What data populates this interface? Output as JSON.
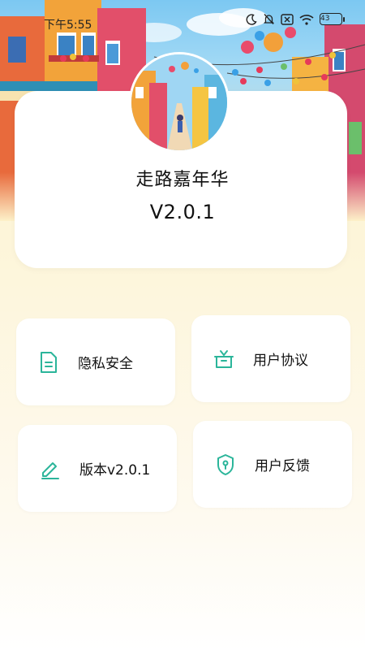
{
  "status_bar": {
    "time": "下午5:55",
    "battery_level": "43",
    "icons": [
      "moon-icon",
      "bell-off-icon",
      "sim-x-icon",
      "wifi-icon",
      "battery-icon"
    ]
  },
  "app": {
    "name": "走路嘉年华",
    "version": "V2.0.1"
  },
  "menu": {
    "privacy": {
      "label": "隐私安全",
      "icon": "document-icon"
    },
    "agreement": {
      "label": "用户协议",
      "icon": "gift-icon"
    },
    "version": {
      "label": "版本v2.0.1",
      "icon": "pencil-icon"
    },
    "feedback": {
      "label": "用户反馈",
      "icon": "shield-icon"
    }
  },
  "colors": {
    "accent": "#2bb59a",
    "background_top": "#fdf1c9",
    "card": "#ffffff",
    "text": "#111111"
  }
}
